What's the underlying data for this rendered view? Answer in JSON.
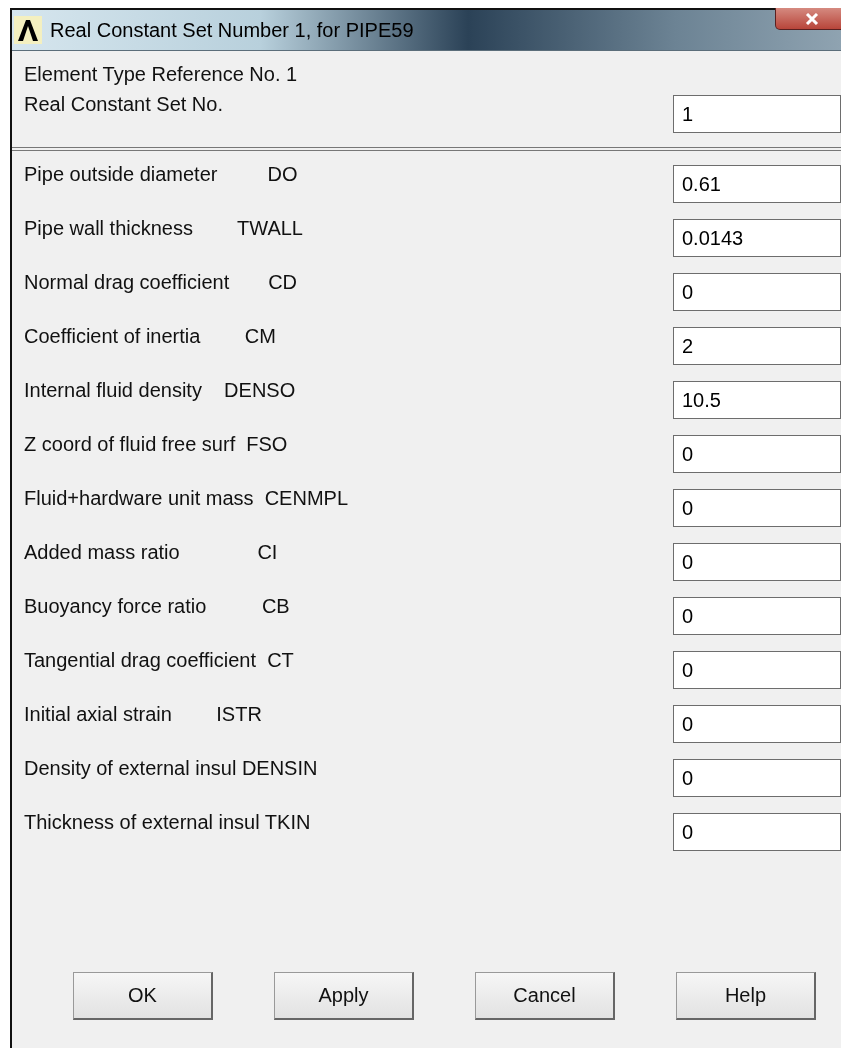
{
  "window": {
    "title": "Real Constant Set Number 1, for PIPE59"
  },
  "header": {
    "reference": "Element Type Reference No. 1",
    "set_label": "Real Constant Set No.",
    "set_value": "1"
  },
  "constants": [
    {
      "label": "Pipe outside diameter         DO",
      "value": "0.61"
    },
    {
      "label": "Pipe wall thickness        TWALL",
      "value": "0.0143"
    },
    {
      "label": "Normal drag coefficient       CD",
      "value": "0"
    },
    {
      "label": "Coefficient of inertia        CM",
      "value": "2"
    },
    {
      "label": "Internal fluid density    DENSO",
      "value": "10.5"
    },
    {
      "label": "Z coord of fluid free surf  FSO",
      "value": "0"
    },
    {
      "label": "Fluid+hardware unit mass  CENMPL",
      "value": "0"
    },
    {
      "label": "Added mass ratio              CI",
      "value": "0"
    },
    {
      "label": "Buoyancy force ratio          CB",
      "value": "0"
    },
    {
      "label": "Tangential drag coefficient  CT",
      "value": "0"
    },
    {
      "label": "Initial axial strain        ISTR",
      "value": "0"
    },
    {
      "label": "Density of external insul DENSIN",
      "value": "0"
    },
    {
      "label": "Thickness of external insul TKIN",
      "value": "0"
    }
  ],
  "buttons": [
    "OK",
    "Apply",
    "Cancel",
    "Help"
  ]
}
